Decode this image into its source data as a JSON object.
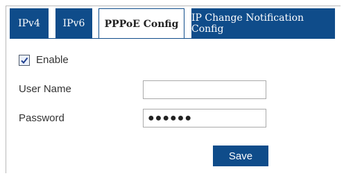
{
  "tabs": [
    {
      "label": "IPv4"
    },
    {
      "label": "IPv6"
    },
    {
      "label": "PPPoE Config"
    },
    {
      "label": "IP Change Notification Config"
    }
  ],
  "active_tab": "PPPoE Config",
  "enable": {
    "label": "Enable",
    "checked": true
  },
  "form": {
    "username_label": "User Name",
    "username_value": "",
    "password_label": "Password",
    "password_value": "●●●●●●"
  },
  "save_label": "Save",
  "colors": {
    "accent": "#0f4c8a"
  }
}
